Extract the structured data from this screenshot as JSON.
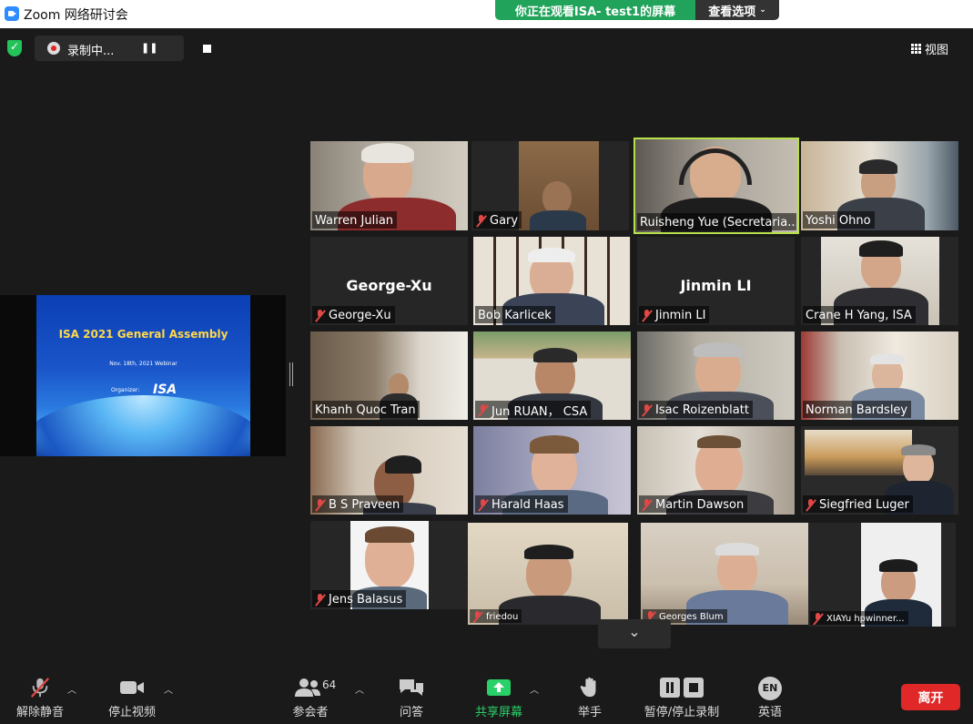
{
  "window": {
    "title": "Zoom 网络研讨会"
  },
  "share_banner": {
    "text": "你正在观看ISA- test1的屏幕",
    "options_label": "查看选项"
  },
  "recording": {
    "label": "录制中..."
  },
  "view_button": {
    "label": "视图"
  },
  "shared_slide": {
    "title": "ISA 2021 General Assembly",
    "date": "Nov. 18th, 2021  Webinar",
    "organizer_label": "Organizer:",
    "organizer_name": "ISA"
  },
  "participants": [
    {
      "name": "Warren Julian",
      "muted": false
    },
    {
      "name": "Gary",
      "muted": true
    },
    {
      "name": "Ruisheng Yue (Secretaria...",
      "muted": false,
      "active_speaker": true
    },
    {
      "name": "Yoshi Ohno",
      "muted": false
    },
    {
      "name": "George-Xu",
      "muted": true,
      "video_off": true
    },
    {
      "name": "Bob Karlicek",
      "muted": false
    },
    {
      "name": "Jinmin LI",
      "muted": true,
      "video_off": true
    },
    {
      "name": "Crane H Yang, ISA",
      "muted": false
    },
    {
      "name": "Khanh Quoc Tran",
      "muted": false
    },
    {
      "name": "Jun RUAN， CSA",
      "muted": true
    },
    {
      "name": "Isac Roizenblatt",
      "muted": true
    },
    {
      "name": "Norman Bardsley",
      "muted": false
    },
    {
      "name": "B S Praveen",
      "muted": true
    },
    {
      "name": "Harald Haas",
      "muted": true
    },
    {
      "name": "Martin Dawson",
      "muted": true
    },
    {
      "name": "Siegfried Luger",
      "muted": true
    },
    {
      "name": "Jens Balasus",
      "muted": true
    },
    {
      "name": "friedou",
      "muted": true
    },
    {
      "name": "Georges Blum",
      "muted": true
    },
    {
      "name": "XIAYu   hpwinner...",
      "muted": true
    }
  ],
  "toolbar": {
    "unmute": "解除静音",
    "stop_video": "停止视频",
    "participants": "参会者",
    "participants_count": "64",
    "qa": "问答",
    "share_screen": "共享屏幕",
    "raise_hand": "举手",
    "pause_stop_recording": "暂停/停止录制",
    "language": "英语",
    "language_badge": "EN",
    "leave": "离开"
  },
  "colors": {
    "accent_green": "#22a35b",
    "active_speaker_border": "#b7e04a",
    "leave_red": "#e02828",
    "muted_red": "#e04848"
  }
}
